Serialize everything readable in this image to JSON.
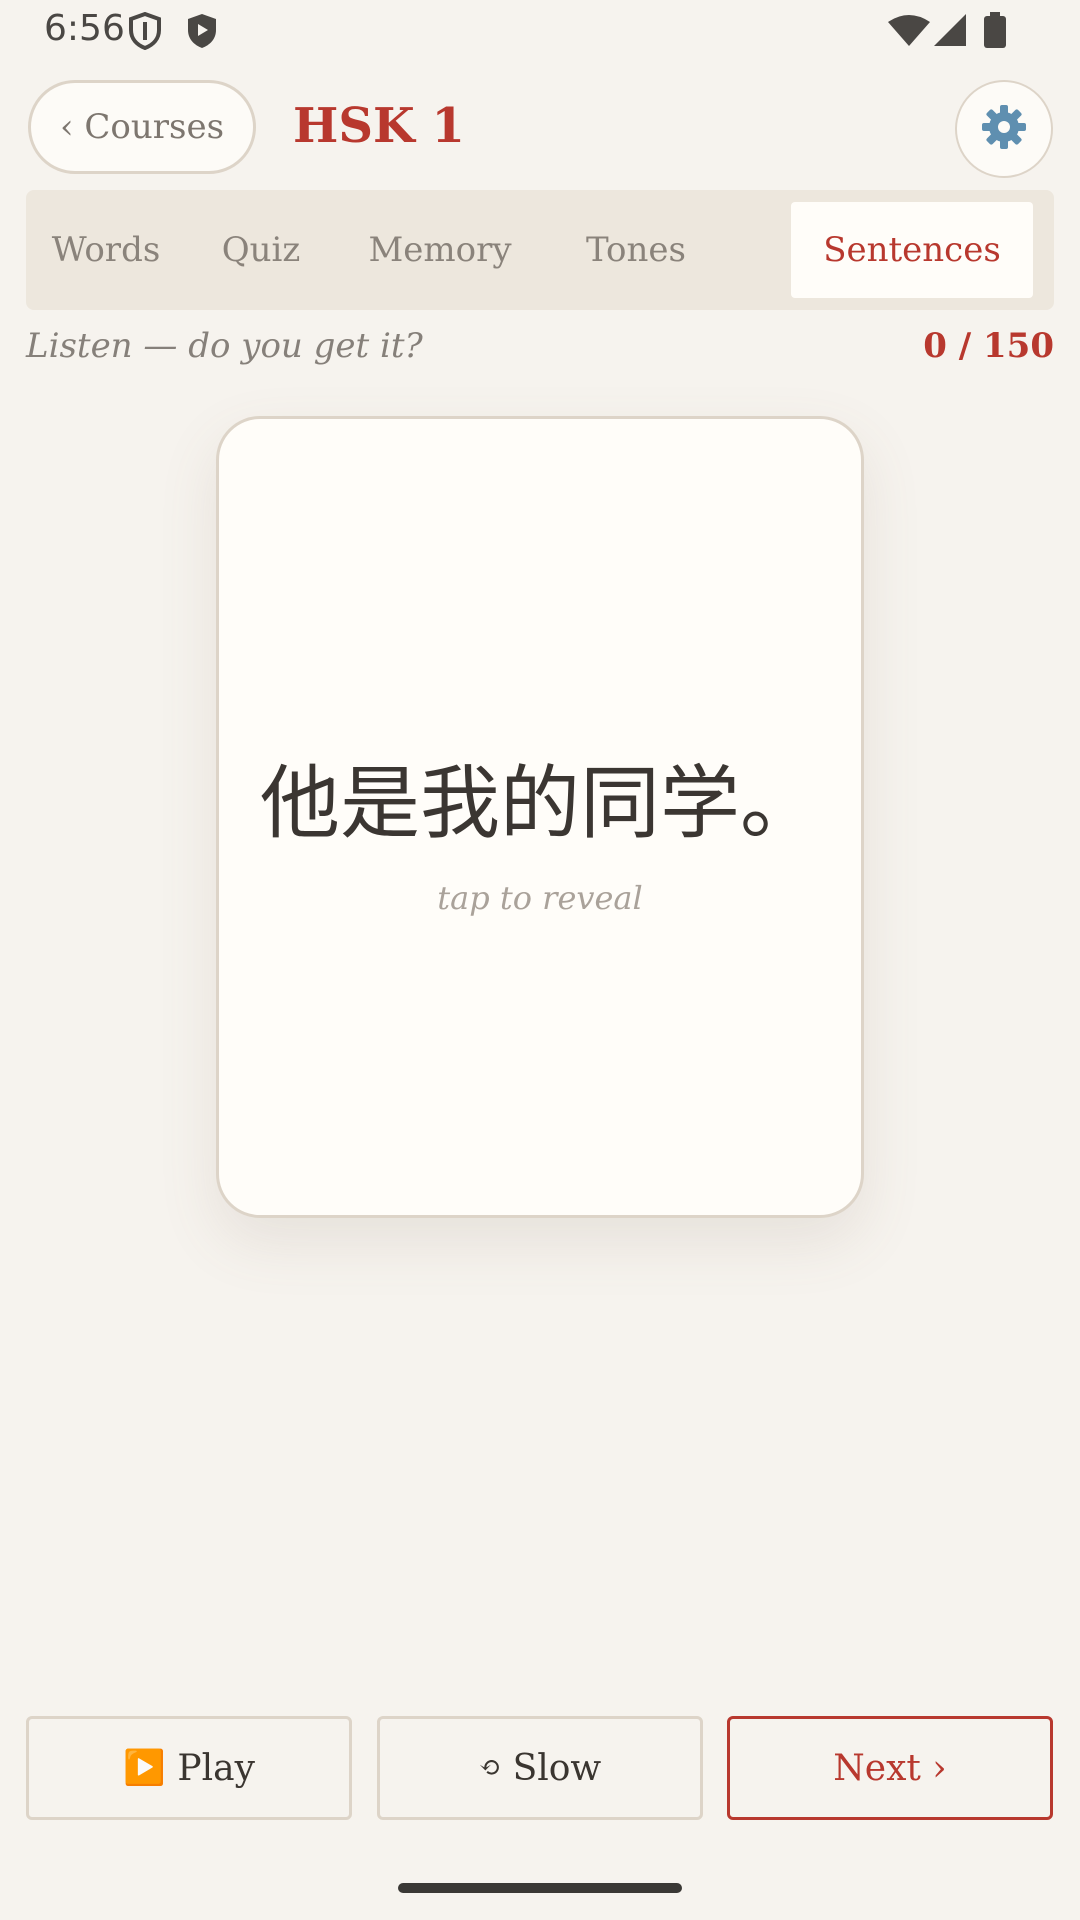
{
  "status_bar": {
    "time": "6:56"
  },
  "header": {
    "back_label": "‹ Courses",
    "title": "HSK 1",
    "settings_icon": "⚙️"
  },
  "tabs": [
    {
      "label": "Words"
    },
    {
      "label": "Quiz"
    },
    {
      "label": "Memory"
    },
    {
      "label": "Tones"
    },
    {
      "label": "Sentences",
      "active": true
    }
  ],
  "exercise": {
    "prompt": "Listen — do you get it?",
    "progress": "0 / 150",
    "sentence": "他是我的同学。",
    "hint": "tap to reveal"
  },
  "controls": {
    "play_icon": "▶️",
    "play_label": "Play",
    "slow_icon": "⟲",
    "slow_label": "Slow",
    "next_label": "Next ›"
  },
  "colors": {
    "accent": "#b8382e",
    "background": "#f6f3ee",
    "card": "#fffdf9",
    "border": "#ddd4c8"
  }
}
